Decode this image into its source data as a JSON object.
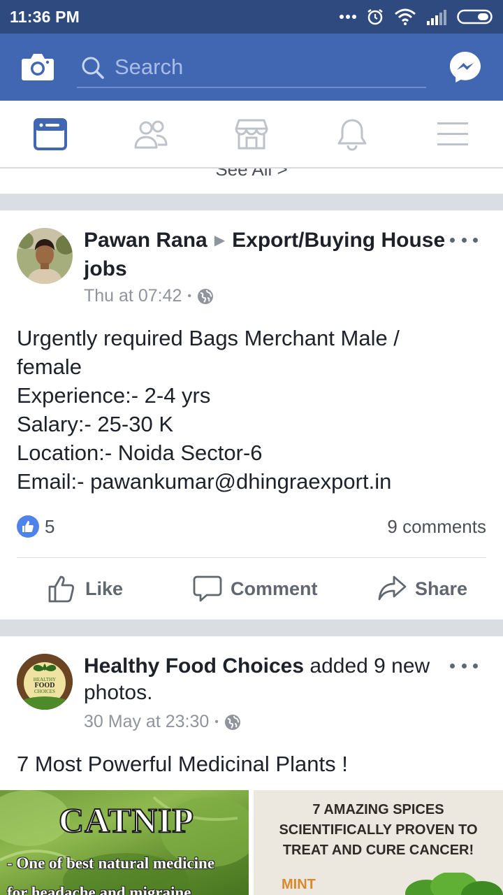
{
  "status_bar": {
    "time": "11:36 PM",
    "icons": [
      "more-dots-icon",
      "alarm-icon",
      "wifi-icon",
      "signal-icon",
      "battery-icon"
    ]
  },
  "header": {
    "search_placeholder": "Search",
    "icons": [
      "camera-icon",
      "search-icon",
      "messenger-icon"
    ]
  },
  "tabs": [
    {
      "name": "news-feed",
      "icon": "news-feed-icon",
      "active": true
    },
    {
      "name": "friends",
      "icon": "friends-icon",
      "active": false
    },
    {
      "name": "marketplace",
      "icon": "marketplace-icon",
      "active": false
    },
    {
      "name": "notifications",
      "icon": "bell-icon",
      "active": false
    },
    {
      "name": "menu",
      "icon": "menu-icon",
      "active": false
    }
  ],
  "see_all_text": "See All >",
  "posts": [
    {
      "author": "Pawan Rana",
      "group": "Export/Buying House jobs",
      "time": "Thu at 07:42",
      "separator": "•",
      "body": [
        "Urgently required Bags Merchant Male / female",
        "Experience:- 2-4 yrs",
        "Salary:- 25-30 K",
        "Location:- Noida Sector-6",
        "Email:- pawankumar@dhingraexport.in"
      ],
      "likes": "5",
      "comments": "9 comments",
      "actions": {
        "like": "Like",
        "comment": "Comment",
        "share": "Share"
      }
    },
    {
      "author": "Healthy Food Choices",
      "action_text": "added 9 new photos.",
      "avatar_text": [
        "HEALTHY",
        "FOOD",
        "CHOICES"
      ],
      "time": "30 May at 23:30",
      "separator": "•",
      "body": "7 Most Powerful Medicinal Plants !",
      "photo_left": {
        "title": "CATNIP",
        "line1": "- One of best natural medicine",
        "line2": "for headache and migraine"
      },
      "photo_right": {
        "lines": [
          "7 AMAZING SPICES",
          "SCIENTIFICALLY PROVEN TO",
          "TREAT AND CURE CANCER!"
        ],
        "label": "MINT"
      }
    }
  ],
  "colors": {
    "status_bar": "#2f4a7e",
    "header": "#4267b2",
    "active_tab": "#4267b2",
    "inactive_tab": "#bec3c9",
    "divider": "#dadde1",
    "like_badge": "#4f83ec"
  }
}
